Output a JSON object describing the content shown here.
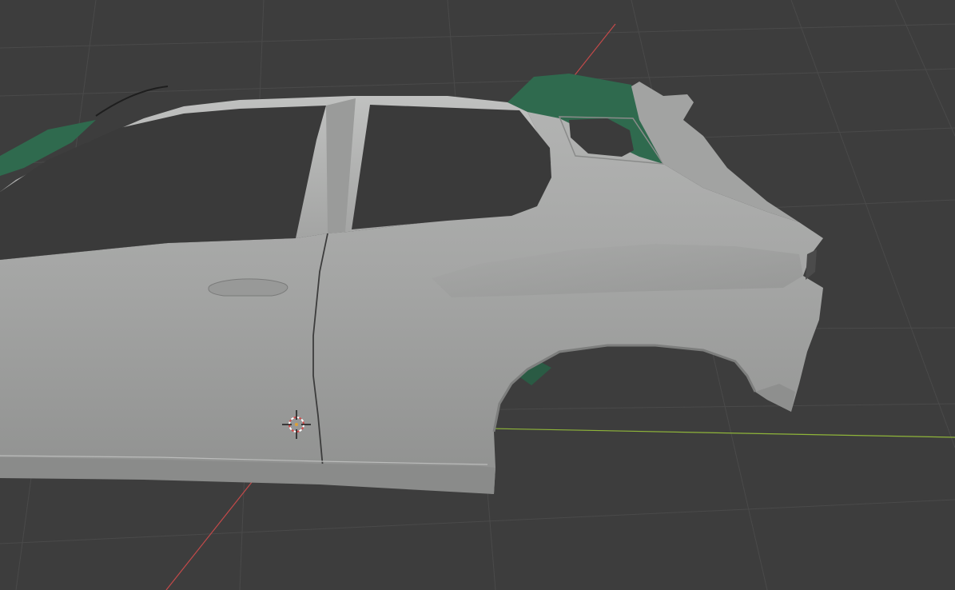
{
  "viewport": {
    "shading": "solid",
    "background_color": "#3d3d3d",
    "grid_color": "#4a4a4a",
    "axis_x_color": "#c44a4a",
    "axis_y_color": "#8fb53a",
    "mesh_body_color": "#a3a4a3",
    "mesh_interior_color": "#2f6a4e",
    "cursor": "3d-cursor-icon"
  }
}
